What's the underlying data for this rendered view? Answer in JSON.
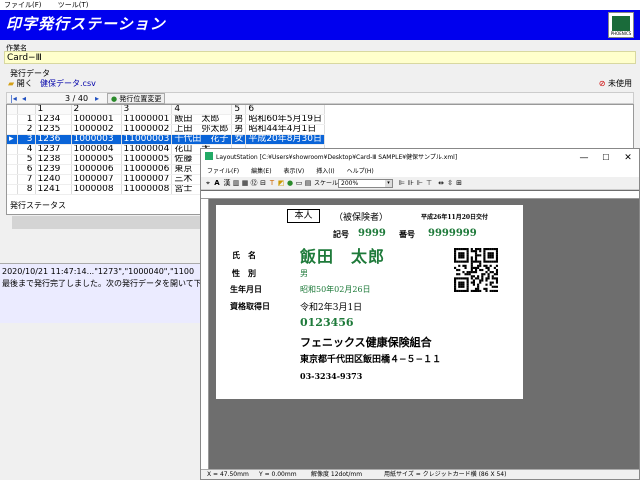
{
  "menubar": {
    "file": "ファイル(F)",
    "tools": "ツール(T)"
  },
  "app": {
    "title": "印字発行ステーション",
    "logo_text": "PHOENICS"
  },
  "work_name": {
    "label": "作業名",
    "value": "Card−Ⅲ"
  },
  "issue_data": {
    "label": "発行データ",
    "open_label": "開く",
    "filename": "健保データ.csv",
    "unused_label": "未使用",
    "nav_position": "3 / 40",
    "change_position_label": "発行位置変更"
  },
  "table": {
    "headers": [
      "",
      "1",
      "2",
      "3",
      "4",
      "5",
      "6"
    ],
    "rows": [
      [
        "1",
        "1234",
        "1000001",
        "11000001",
        "飯田　太郎",
        "男",
        "昭和60年5月19日"
      ],
      [
        "2",
        "1235",
        "1000002",
        "11000002",
        "上田　弥太郎",
        "男",
        "昭和44年4月1日"
      ],
      [
        "3",
        "1236",
        "1000003",
        "11000003",
        "千代田　花子",
        "女",
        "平成20年8月30日"
      ],
      [
        "4",
        "1237",
        "1000004",
        "11000004",
        "花山　太",
        "",
        ""
      ],
      [
        "5",
        "1238",
        "1000005",
        "11000005",
        "佐藤　一",
        "",
        ""
      ],
      [
        "6",
        "1239",
        "1000006",
        "11000006",
        "東京　次",
        "",
        ""
      ],
      [
        "7",
        "1240",
        "1000007",
        "11000007",
        "三木　三",
        "",
        ""
      ],
      [
        "8",
        "1241",
        "1000008",
        "11000008",
        "宮士　山",
        "",
        ""
      ]
    ],
    "selected_index": 2
  },
  "status": {
    "label": "発行ステータス"
  },
  "log": {
    "line1": "2020/10/21 11:47:14...\"1273\",\"1000040\",\"1100",
    "line2": "最後まで発行完了しました。次の発行データを開いて下"
  },
  "layout_station": {
    "title": "LayoutStation [C:¥Users¥showroom¥Desktop¥Card-Ⅲ SAMPLE¥健保サンプル.xml]",
    "menu": [
      "ファイル(F)",
      "編集(E)",
      "表示(V)",
      "挿入(I)",
      "ヘルプ(H)"
    ],
    "scale_label": "スケール",
    "zoom": "200%",
    "status": {
      "x": "X = 47.50mm",
      "y": "Y = 0.00mm",
      "resolution": "解像度 12dot/mm",
      "paper": "用紙サイズ = クレジットカード横 (86 X 54)"
    }
  },
  "card": {
    "honnin": "本人",
    "insured": "（被保険者）",
    "issued": "平成26年11月20日交付",
    "kigou_label": "記号",
    "kigou_value": "9999",
    "bangou_label": "番号",
    "bangou_value": "9999999",
    "name_label": "氏　名",
    "name_value": "飯田　太郎",
    "sex_label": "性　別",
    "sex_value": "男",
    "dob_label": "生年月日",
    "dob_value": "昭和50年02月26日",
    "qual_label": "資格取得日",
    "qual_value": "令和2年3月1日",
    "code": "0123456",
    "org": "フェニックス健康保険組合",
    "address": "東京都千代田区飯田橋４−５−１１",
    "phone": "03-3234-9373"
  }
}
